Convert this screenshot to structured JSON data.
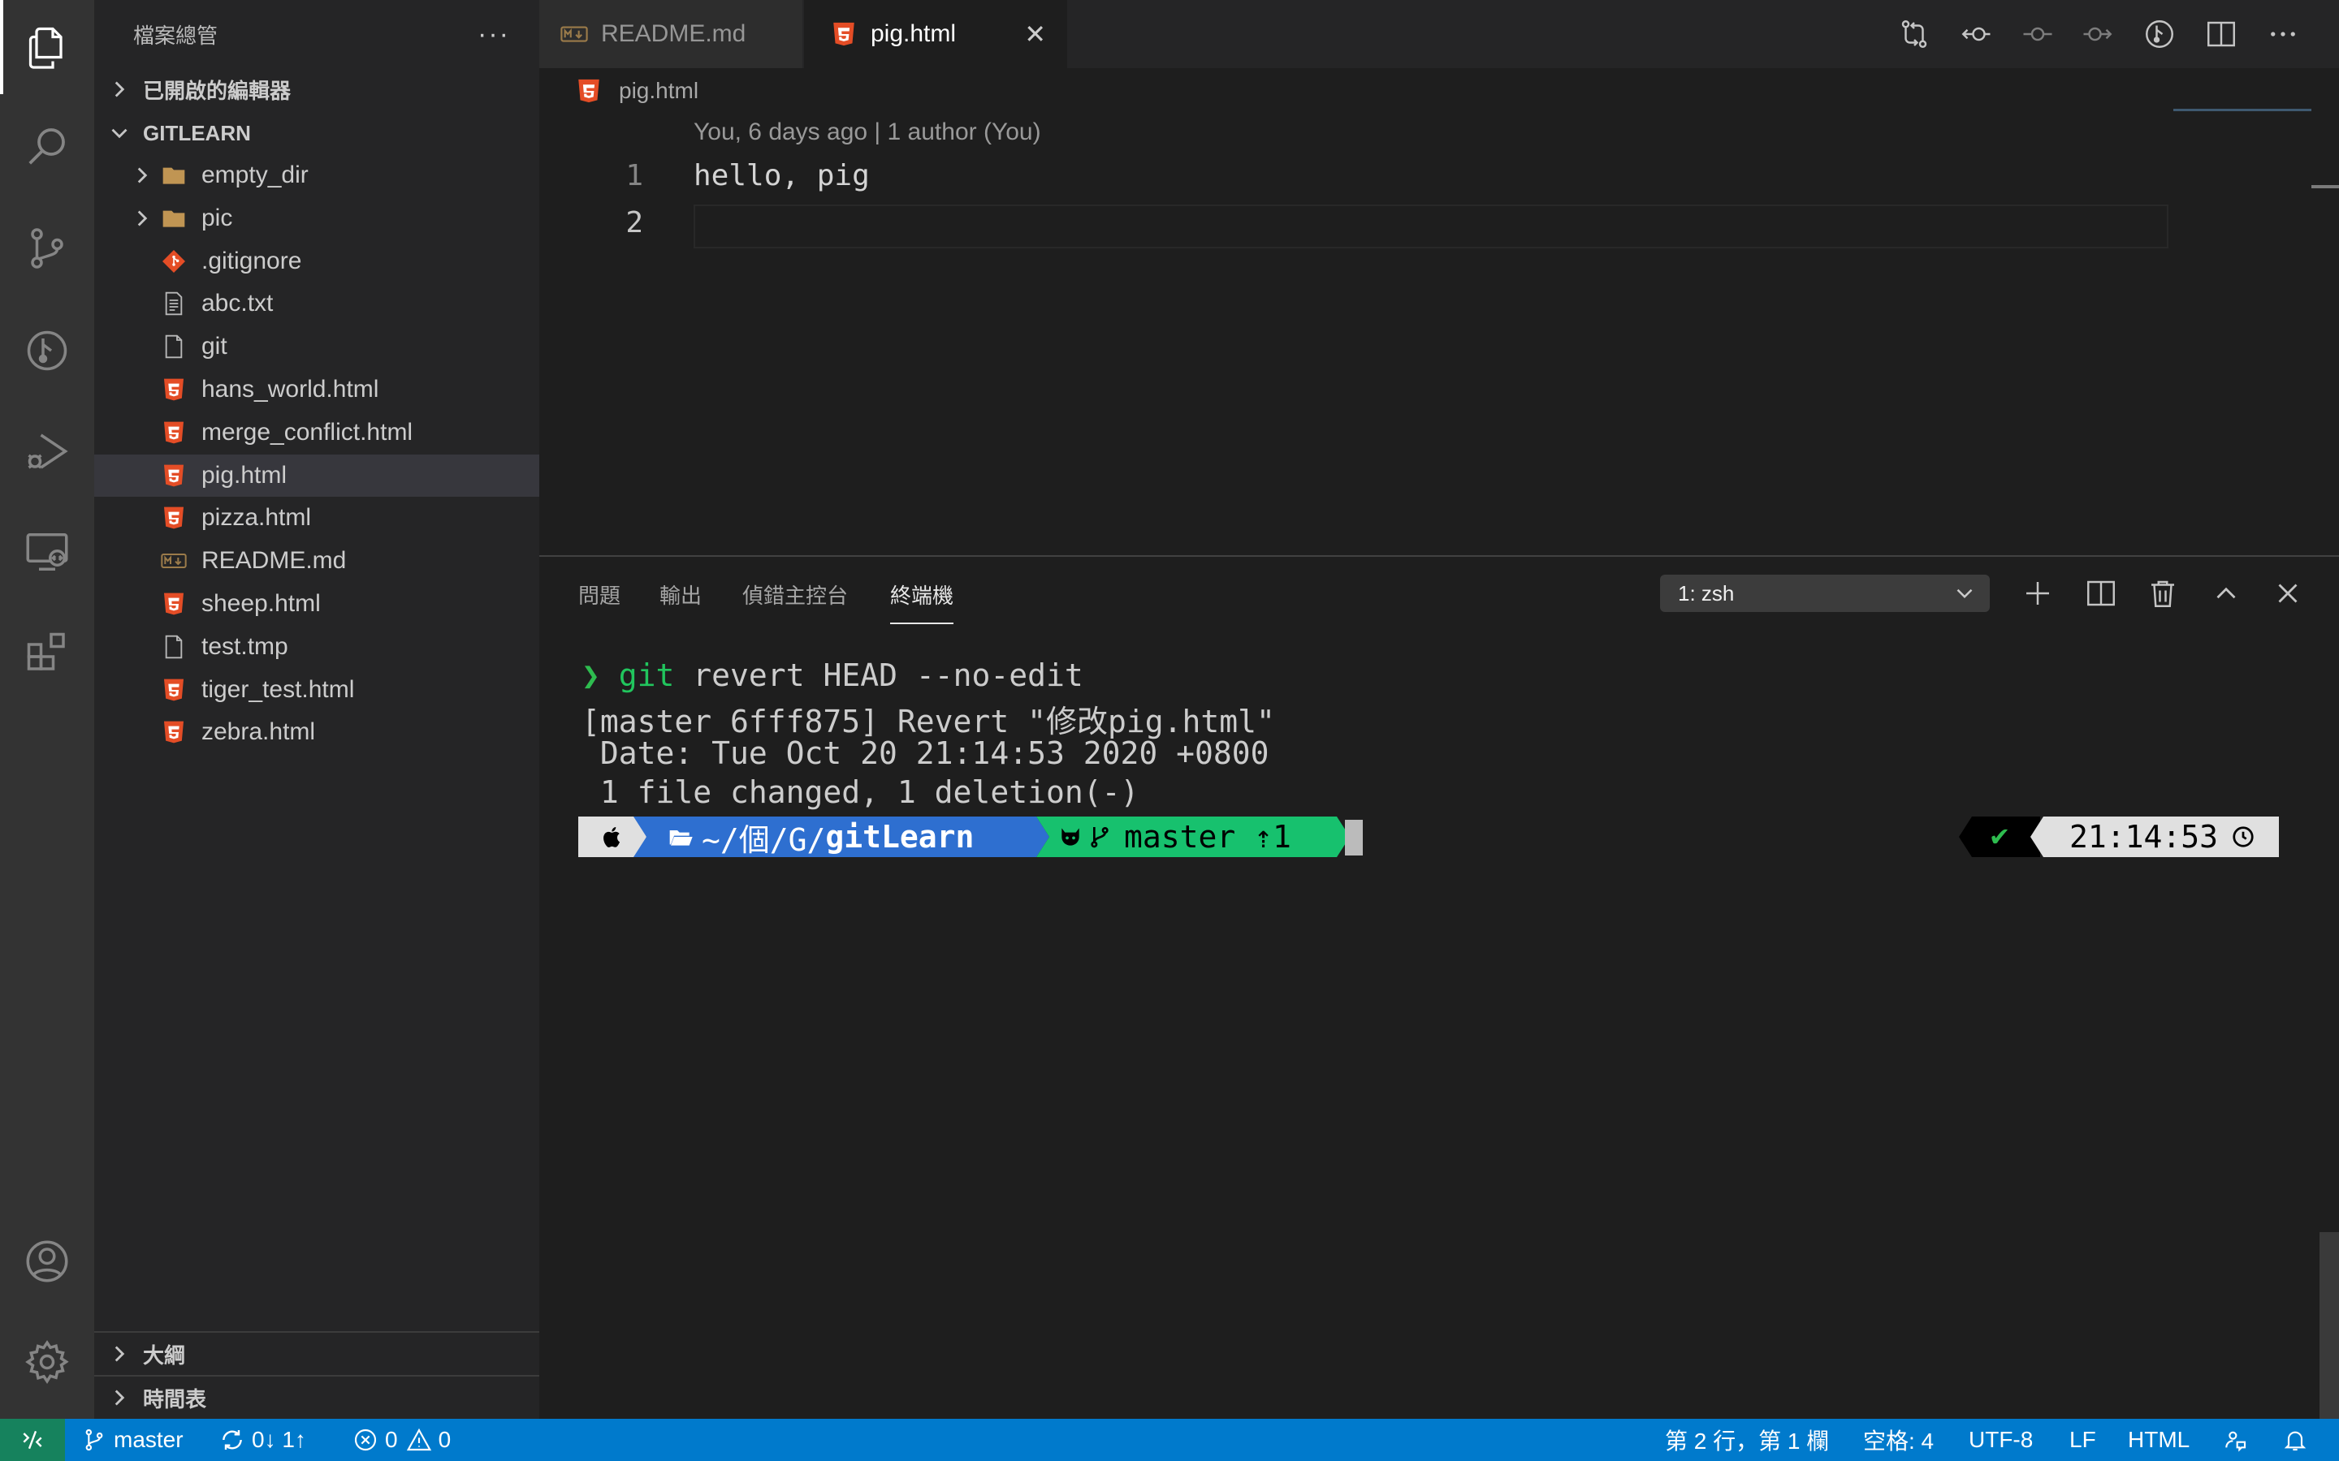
{
  "sidebar": {
    "title": "檔案總管",
    "more": "···",
    "open_editors": "已開啟的編輯器",
    "workspace": "GITLEARN",
    "files": [
      {
        "name": "empty_dir",
        "type": "folder"
      },
      {
        "name": "pic",
        "type": "folder"
      },
      {
        "name": ".gitignore",
        "type": "git"
      },
      {
        "name": "abc.txt",
        "type": "text"
      },
      {
        "name": "git",
        "type": "file"
      },
      {
        "name": "hans_world.html",
        "type": "html"
      },
      {
        "name": "merge_conflict.html",
        "type": "html"
      },
      {
        "name": "pig.html",
        "type": "html",
        "selected": true
      },
      {
        "name": "pizza.html",
        "type": "html"
      },
      {
        "name": "README.md",
        "type": "markdown"
      },
      {
        "name": "sheep.html",
        "type": "html"
      },
      {
        "name": "test.tmp",
        "type": "file"
      },
      {
        "name": "tiger_test.html",
        "type": "html"
      },
      {
        "name": "zebra.html",
        "type": "html"
      }
    ],
    "outline": "大綱",
    "timeline": "時間表"
  },
  "tabs": [
    {
      "label": "README.md",
      "icon": "markdown-icon"
    },
    {
      "label": "pig.html",
      "icon": "html-icon",
      "close": "✕"
    }
  ],
  "editor": {
    "breadcrumb": "pig.html",
    "codelens": "You, 6 days ago | 1 author (You)",
    "line_numbers": [
      "1",
      "2"
    ],
    "lines": [
      "hello, pig",
      ""
    ]
  },
  "panel": {
    "tabs": [
      "問題",
      "輸出",
      "偵錯主控台",
      "終端機"
    ],
    "active_tab": "終端機",
    "terminal_select": "1: zsh",
    "terminal": {
      "prompt_symbol": "❯",
      "cmd_git": "git",
      "cmd_rest": " revert HEAD --no-edit",
      "out1": "[master 6fff875] Revert \"修改pig.html\"",
      "out2": " Date: Tue Oct 20 21:14:53 2020 +0800",
      "out3": " 1 file changed, 1 deletion(-)",
      "path_prefix": "~/個/G/",
      "path_dir": "gitLearn",
      "branch": "master ⇡1",
      "check": "✔",
      "time": "21:14:53"
    }
  },
  "statusbar": {
    "branch": "master",
    "sync": "0↓ 1↑",
    "errors": "0",
    "warnings": "0",
    "position": "第 2 行，第 1 欄",
    "spaces": "空格: 4",
    "encoding": "UTF-8",
    "eol": "LF",
    "language": "HTML"
  },
  "colors": {
    "accent": "#007acc",
    "remote": "#16825d",
    "html_icon": "#e44d26",
    "folder": "#c09553",
    "git_green": "#2ebc4f",
    "path_blue": "#2e6fd0",
    "branch_green": "#17c16e"
  }
}
